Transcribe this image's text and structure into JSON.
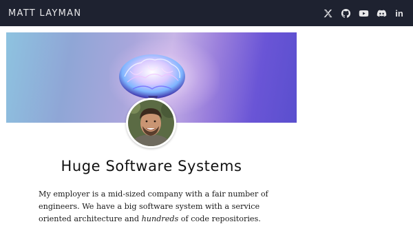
{
  "header": {
    "site_title": "MATT LAYMAN",
    "social": [
      {
        "icon": "x-twitter-icon"
      },
      {
        "icon": "github-icon"
      },
      {
        "icon": "youtube-icon"
      },
      {
        "icon": "discord-icon"
      },
      {
        "icon": "linkedin-icon",
        "label": "in"
      }
    ]
  },
  "colors": {
    "header_bg": "#1e2230",
    "header_text": "#e8e8ea",
    "banner_left": "#8ec3e0",
    "banner_right": "#5a4fce"
  },
  "post": {
    "title": "Huge Software Systems",
    "paragraph_1_a": "My employer is a mid-sized company with a fair number of engineers. We have a big software system with a service oriented architecture and ",
    "paragraph_1_em": "hundreds",
    "paragraph_1_b": " of code repositories."
  }
}
